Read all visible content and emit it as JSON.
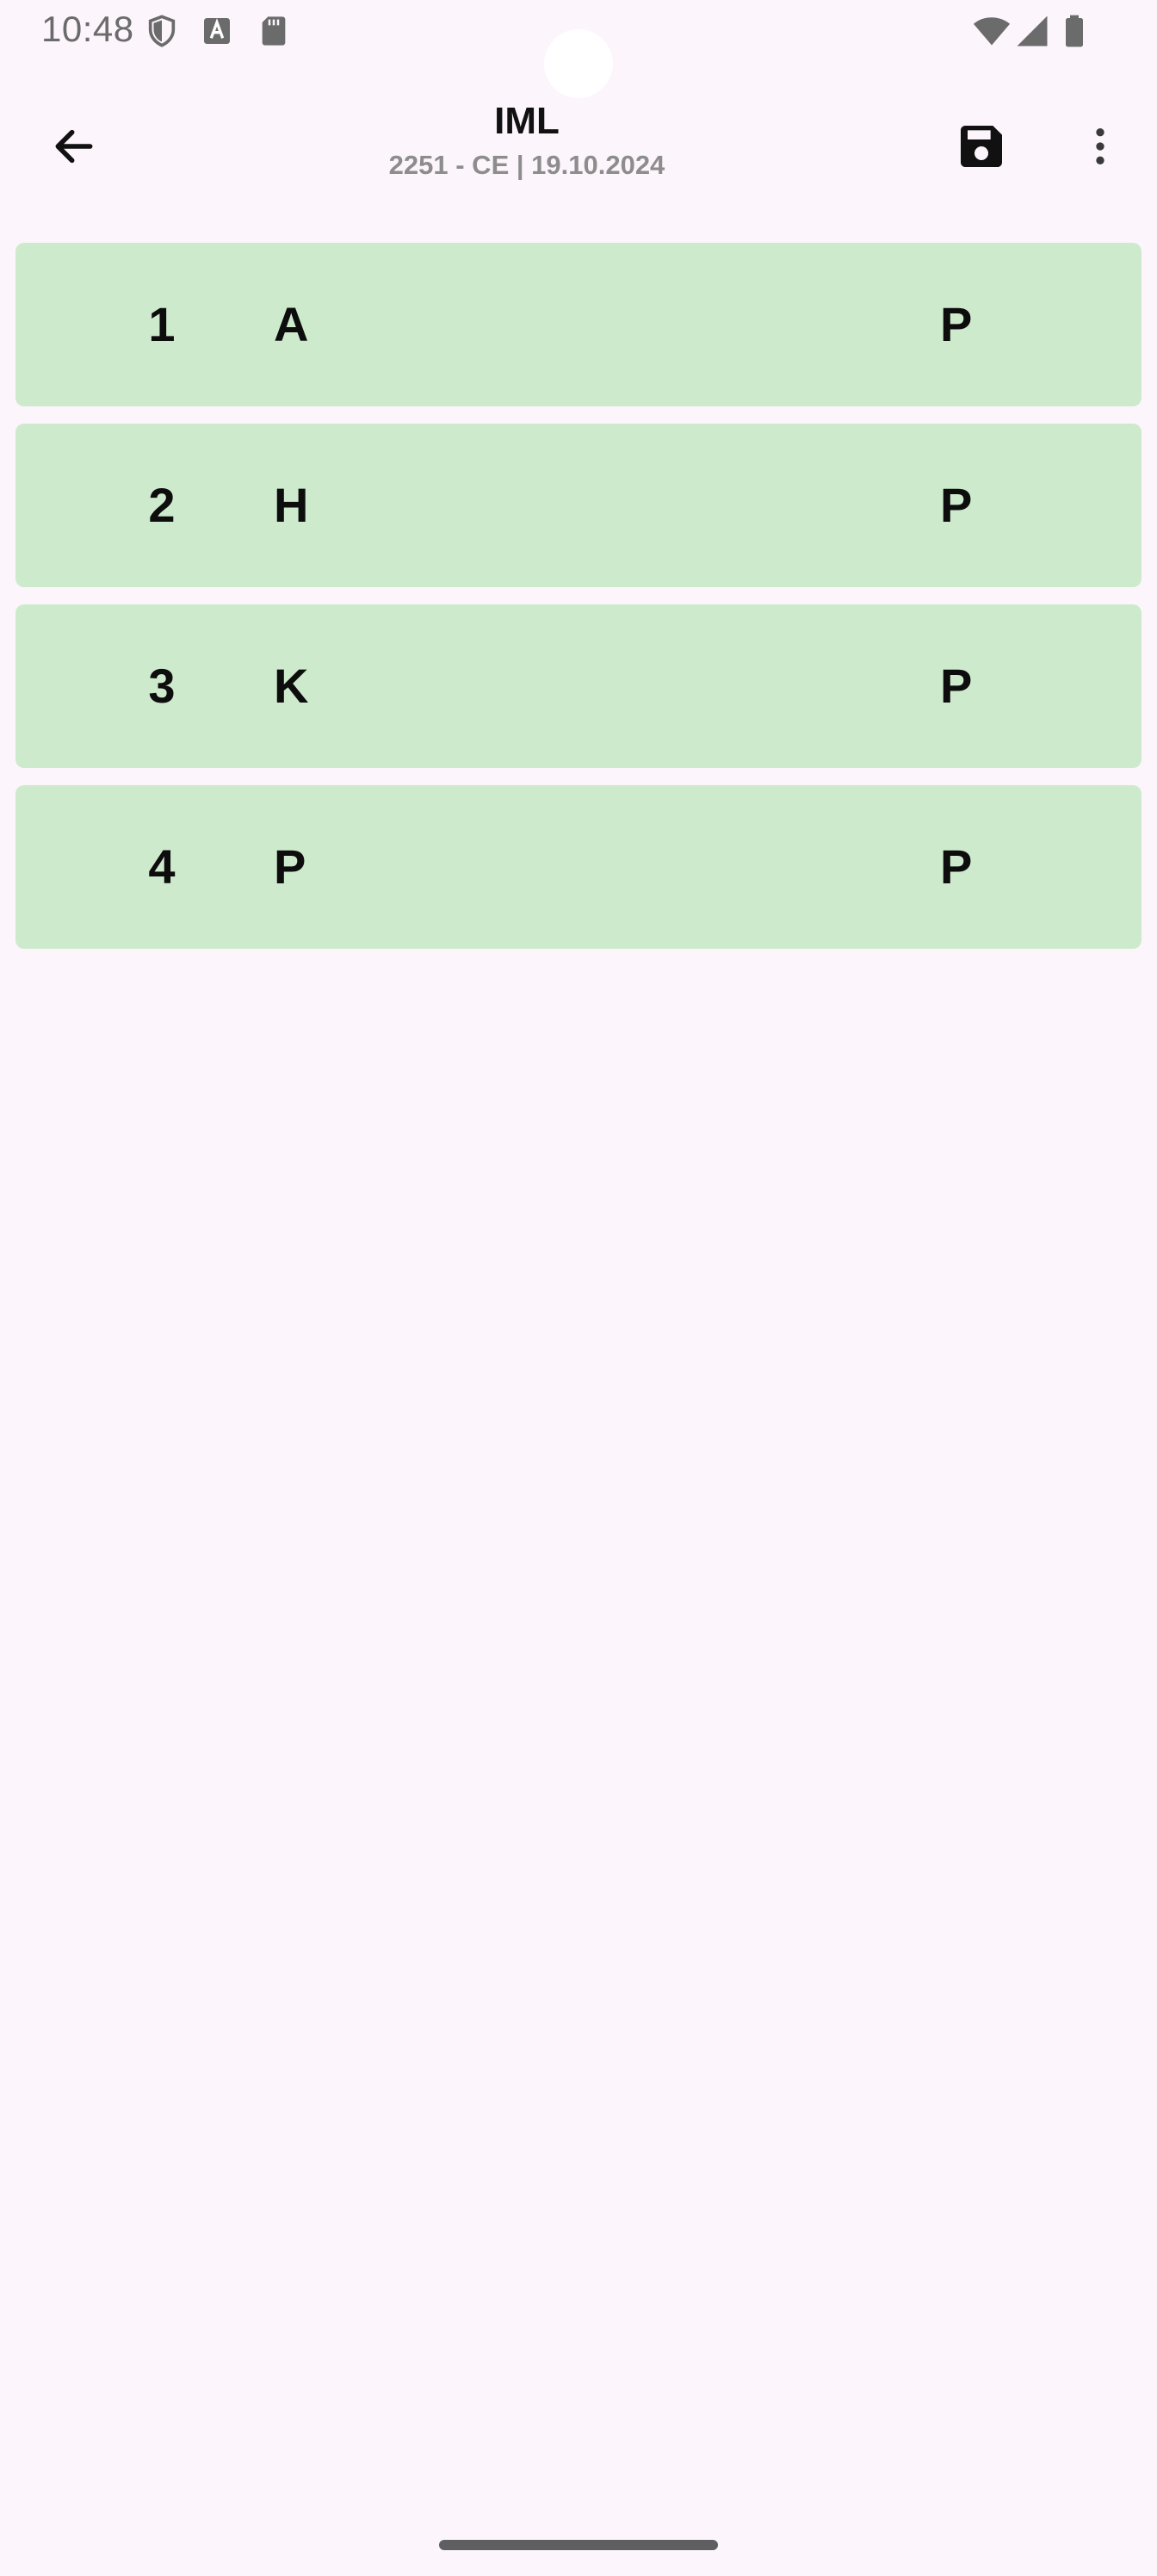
{
  "status_bar": {
    "time": "10:48",
    "left_icons": [
      "shield-icon",
      "text-a-icon",
      "sd-card-icon"
    ],
    "right_icons": [
      "wifi-icon",
      "cell-signal-icon",
      "battery-icon"
    ]
  },
  "app_bar": {
    "title": "IML",
    "subtitle": "2251 - CE | 19.10.2024",
    "back_icon": "arrow-left-icon",
    "save_icon": "floppy-disk-icon",
    "more_icon": "more-vertical-icon"
  },
  "rows": [
    {
      "number": "1",
      "name": "A",
      "status": "P"
    },
    {
      "number": "2",
      "name": "H",
      "status": "P"
    },
    {
      "number": "3",
      "name": "K",
      "status": "P"
    },
    {
      "number": "4",
      "name": "P",
      "status": "P"
    }
  ],
  "colors": {
    "background": "#fcf5fc",
    "row_background": "#cdebcc",
    "text": "#0d0d0d",
    "subtitle": "#8d8d8d"
  }
}
